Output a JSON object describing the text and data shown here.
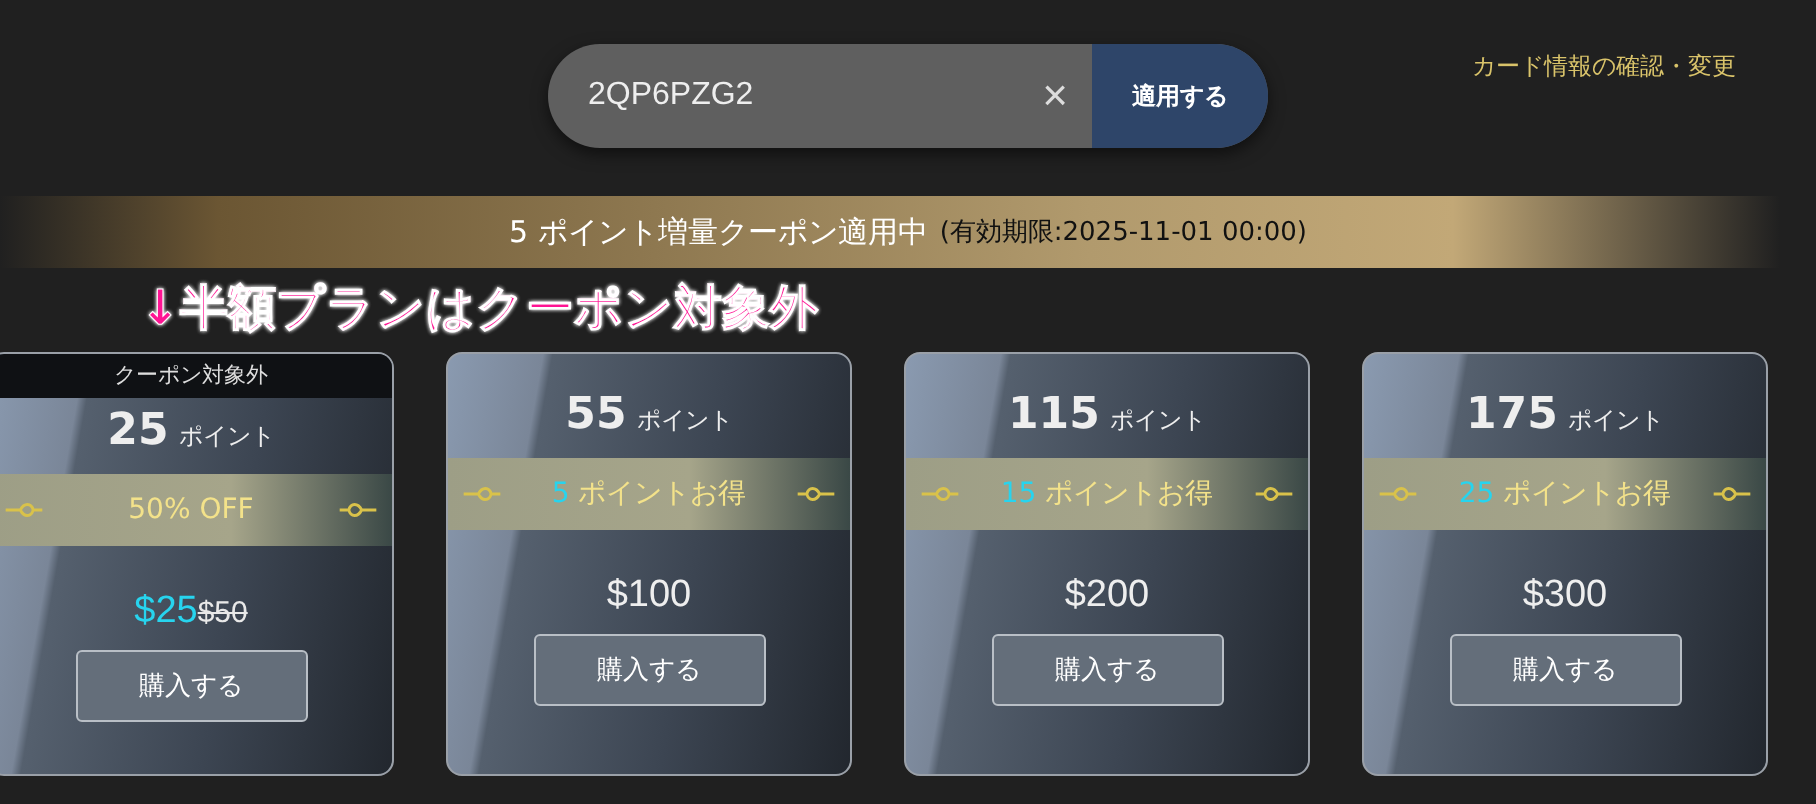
{
  "coupon_field": {
    "value": "2QP6PZG2",
    "clear": "×",
    "apply_button": "適用する"
  },
  "card_link": "カード情報の確認・変更",
  "banner": {
    "title": "5 ポイント増量クーポン適用中",
    "expiry": "(有効期限:2025-11-01 00:00)"
  },
  "annotation": "↓半額プランはクーポン対象外",
  "plans": [
    {
      "tag": "クーポン対象外",
      "points": "25",
      "unit": "ポイント",
      "kind": "discount",
      "offer": "50% OFF",
      "price": "$25",
      "original_price": "$50",
      "buy": "購入する"
    },
    {
      "points": "55",
      "unit": "ポイント",
      "kind": "bonus",
      "bonus_number": "5",
      "offer": "ポイントお得",
      "price": "$100",
      "buy": "購入する"
    },
    {
      "points": "115",
      "unit": "ポイント",
      "kind": "bonus",
      "bonus_number": "15",
      "offer": "ポイントお得",
      "price": "$200",
      "buy": "購入する"
    },
    {
      "points": "175",
      "unit": "ポイント",
      "kind": "bonus",
      "bonus_number": "25",
      "offer": "ポイントお得",
      "price": "$300",
      "buy": "購入する"
    }
  ]
}
